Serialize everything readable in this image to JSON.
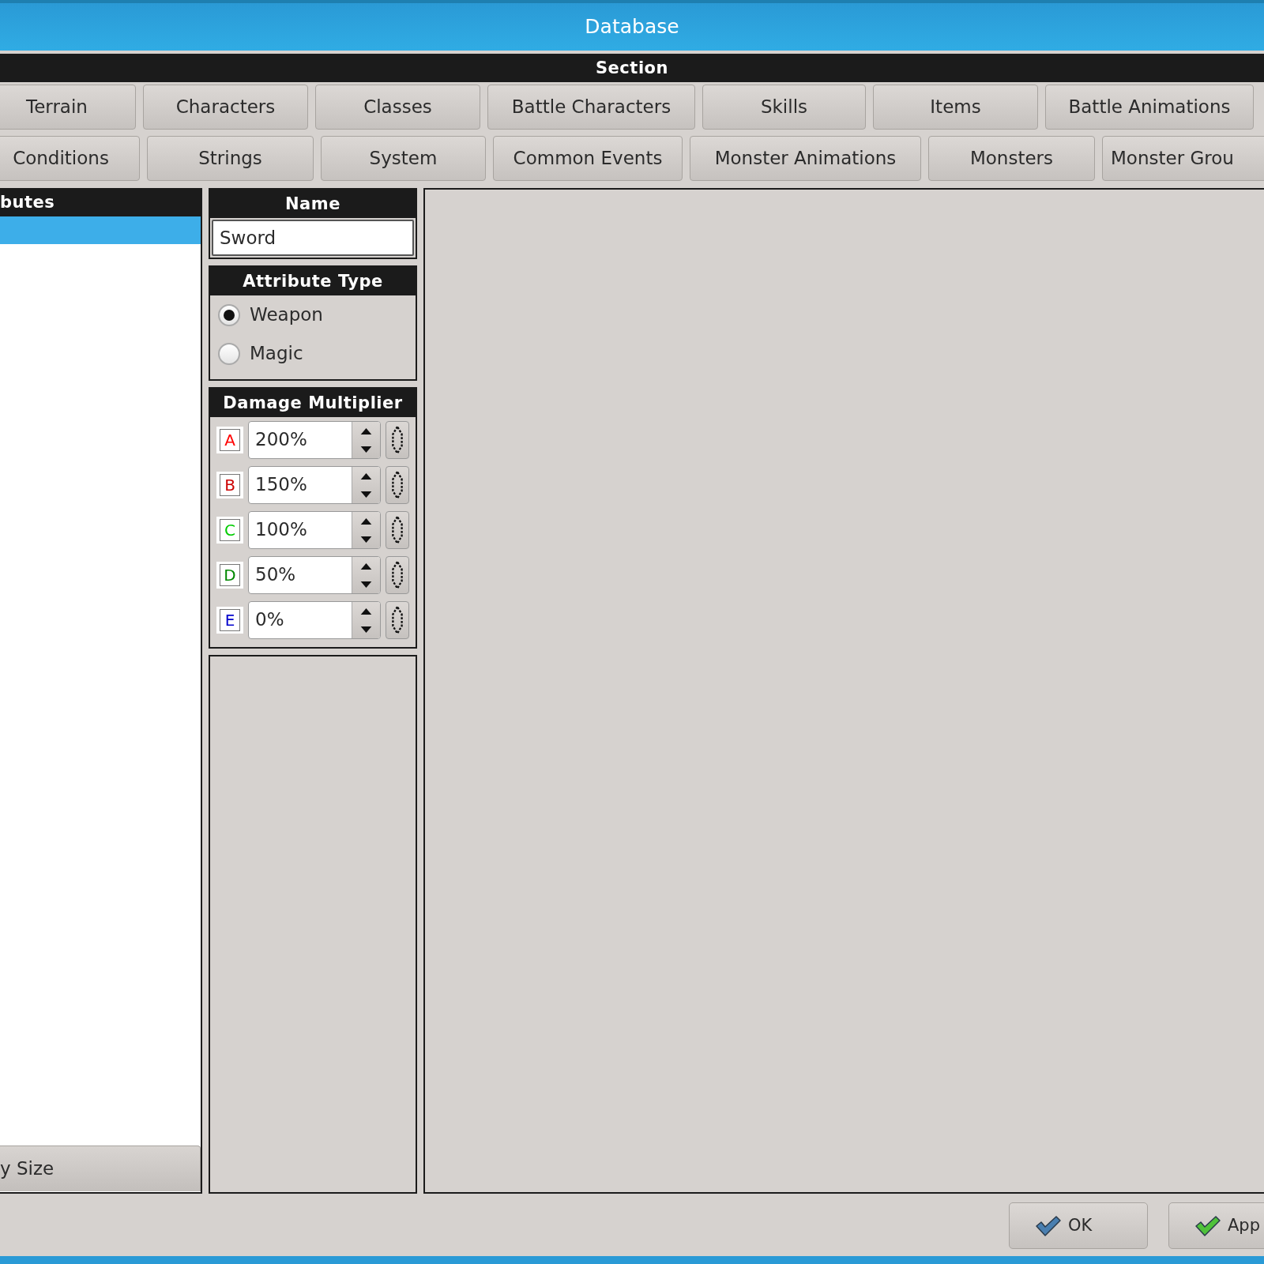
{
  "window": {
    "title": "Database"
  },
  "section": {
    "header": "Section",
    "tab_rows": [
      [
        {
          "label": "Terrain"
        },
        {
          "label": "Characters"
        },
        {
          "label": "Classes"
        },
        {
          "label": "Battle Characters"
        },
        {
          "label": "Skills"
        },
        {
          "label": "Items"
        },
        {
          "label": "Battle Animations"
        }
      ],
      [
        {
          "label": "Conditions"
        },
        {
          "label": "Strings"
        },
        {
          "label": "System"
        },
        {
          "label": "Common Events"
        },
        {
          "label": "Monster Animations"
        },
        {
          "label": "Monsters"
        },
        {
          "label": "Monster Grou"
        }
      ]
    ]
  },
  "list": {
    "header": "butes",
    "rows": [
      {
        "selected": true
      }
    ],
    "button": "y Size"
  },
  "name": {
    "header": "Name",
    "value": "Sword"
  },
  "attribute_type": {
    "header": "Attribute Type",
    "options": [
      {
        "label": "Weapon",
        "selected": true
      },
      {
        "label": "Magic",
        "selected": false
      }
    ]
  },
  "damage_multiplier": {
    "header": "Damage Multiplier",
    "rows": [
      {
        "letter": "A",
        "color": "#ff0000",
        "value": "200%"
      },
      {
        "letter": "B",
        "color": "#cc0000",
        "value": "150%"
      },
      {
        "letter": "C",
        "color": "#00cc00",
        "value": "100%"
      },
      {
        "letter": "D",
        "color": "#008800",
        "value": "50%"
      },
      {
        "letter": "E",
        "color": "#0000cc",
        "value": "0%"
      }
    ]
  },
  "buttons": [
    {
      "label": "OK",
      "kind": "ok"
    },
    {
      "label": "App",
      "kind": "apply"
    }
  ]
}
